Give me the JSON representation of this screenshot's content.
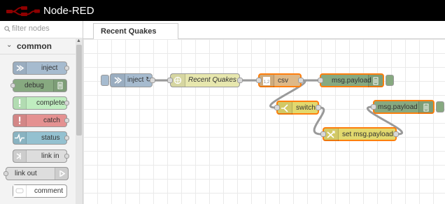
{
  "app": {
    "title": "Node-RED"
  },
  "palette": {
    "filter_placeholder": "filter nodes",
    "category": "common",
    "nodes": [
      {
        "label": "inject",
        "color": "#a6bbcf",
        "icon": "arrow-right-icon"
      },
      {
        "label": "debug",
        "color": "#87a980",
        "icon": "list-icon"
      },
      {
        "label": "complete",
        "color": "#c0edc0",
        "icon": "exclamation-icon"
      },
      {
        "label": "catch",
        "color": "#e49191",
        "icon": "exclamation-icon"
      },
      {
        "label": "status",
        "color": "#94c1d0",
        "icon": "pulse-icon"
      },
      {
        "label": "link in",
        "color": "#dddddd",
        "icon": "link-in-icon"
      },
      {
        "label": "link out",
        "color": "#dddddd",
        "icon": "link-out-icon"
      },
      {
        "label": "comment",
        "color": "#ffffff",
        "icon": "comment-icon"
      }
    ]
  },
  "tabs": [
    {
      "label": "Recent Quakes",
      "active": true
    }
  ],
  "flow": {
    "nodes": [
      {
        "label": "inject ↻",
        "type": "inject",
        "color": "#a6bbcf"
      },
      {
        "label": "Recent Quakes",
        "type": "http request",
        "color": "#e7e7ae"
      },
      {
        "label": "csv",
        "type": "csv",
        "color": "#deb887"
      },
      {
        "label": "msg.payload",
        "type": "debug",
        "color": "#87a980"
      },
      {
        "label": "switch",
        "type": "switch",
        "color": "#e2d96e"
      },
      {
        "label": "set msg.payload",
        "type": "change",
        "color": "#e2d96e"
      },
      {
        "label": "msg.payload",
        "type": "debug",
        "color": "#87a980"
      }
    ]
  },
  "colors": {
    "header_bg": "#000000",
    "selection": "#ff7f0e",
    "accent": "#8f0000"
  }
}
